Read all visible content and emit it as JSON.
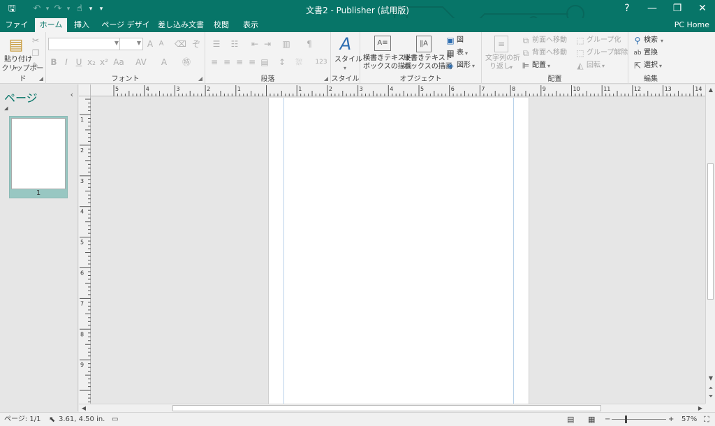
{
  "window": {
    "title": "文書2 - Publisher (試用版)",
    "controls": {
      "help": "?",
      "minimize": "—",
      "restore": "❐",
      "close": "✕"
    }
  },
  "qat": {
    "save": "🖫",
    "undo": "↶",
    "undo_arrow": "▾",
    "redo": "↷",
    "redo_arrow": "▾",
    "pointer": "☝",
    "pointer_arrow": "▾",
    "customize": "▾"
  },
  "tabs": [
    {
      "label": "ファイル",
      "active": false
    },
    {
      "label": "ホーム",
      "active": true
    },
    {
      "label": "挿入",
      "active": false
    },
    {
      "label": "ページ デザイン",
      "active": false
    },
    {
      "label": "差し込み文書",
      "active": false
    },
    {
      "label": "校閲",
      "active": false
    },
    {
      "label": "表示",
      "active": false
    }
  ],
  "account": "PC Home",
  "ribbon": {
    "clipboard": {
      "label": "クリップボード",
      "paste": "貼り付け",
      "paste_arrow": "▾"
    },
    "font": {
      "label": "フォント"
    },
    "paragraph": {
      "label": "段落"
    },
    "style": {
      "label": "スタイル",
      "button": "スタイル",
      "arrow": "▾"
    },
    "objects": {
      "label": "オブジェクト",
      "htext_line1": "横書きテキスト",
      "htext_line2": "ボックスの描画",
      "vtext_line1": "縦書きテキスト",
      "vtext_line2": "ボックスの描画",
      "picture": "図",
      "table": "表",
      "table_arrow": "▾",
      "shapes": "図形",
      "shapes_arrow": "▾"
    },
    "arrange": {
      "label": "配置",
      "wrap_line1": "文字列の折",
      "wrap_line2": "り返し",
      "wrap_arrow": "▾",
      "bring_forward": "前面へ移動",
      "send_backward": "背面へ移動",
      "align": "配置",
      "align_arrow": "▾",
      "group": "グループ化",
      "ungroup": "グループ解除",
      "rotate": "回転",
      "rotate_arrow": "▾"
    },
    "editing": {
      "label": "編集",
      "find": "検索",
      "find_arrow": "▾",
      "replace": "置換",
      "select": "選択",
      "select_arrow": "▾"
    }
  },
  "pages_pane": {
    "title": "ページ",
    "collapse": "‹",
    "expand": "◢",
    "thumb_number": "1"
  },
  "ruler": {
    "h_labels": [
      "5",
      "4",
      "3",
      "2",
      "1",
      "",
      "1",
      "2",
      "3",
      "4",
      "5",
      "6",
      "7",
      "8",
      "9",
      "10",
      "11",
      "12",
      "13",
      "14"
    ],
    "v_labels": [
      "1",
      "2",
      "3",
      "4",
      "5",
      "6",
      "7",
      "8",
      "9"
    ]
  },
  "status": {
    "page": "ページ: 1/1",
    "position": "3.61, 4.50 in.",
    "zoom": "57%",
    "zoom_minus": "−",
    "zoom_plus": "+"
  }
}
